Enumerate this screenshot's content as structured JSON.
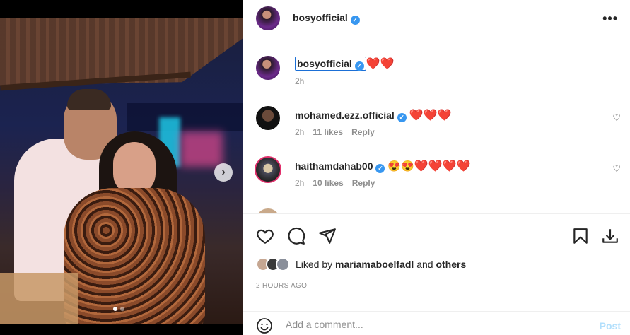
{
  "post": {
    "author": "bosyofficial",
    "more_label": "•••",
    "next_label": "›"
  },
  "comments": [
    {
      "username": "bosyofficial",
      "text": "❤️❤️",
      "time": "2h"
    },
    {
      "username": "mohamed.ezz.official",
      "text": "❤️❤️❤️",
      "time": "2h",
      "likes": "11 likes",
      "reply": "Reply"
    },
    {
      "username": "haithamdahab00",
      "emoji_faces": "😍😍",
      "text": "❤️❤️❤️❤️",
      "time": "2h",
      "likes": "10 likes",
      "reply": "Reply"
    }
  ],
  "likes": {
    "prefix": "Liked by",
    "user": "mariamaboelfadl",
    "middle": "and",
    "others": "others"
  },
  "timestamp": "2 HOURS AGO",
  "add_comment": {
    "placeholder": "Add a comment...",
    "post_label": "Post"
  },
  "carousel": {
    "total": 2,
    "active": 0
  }
}
